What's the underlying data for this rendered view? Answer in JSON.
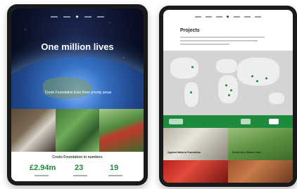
{
  "left_tablet": {
    "hero_title": "One million lives",
    "hero_subtitle": "Credo Foundation lives three priority areas",
    "numbers_title": "Credo Foundation in numbers",
    "stats": [
      "£2.94m",
      "23",
      "19"
    ]
  },
  "right_tablet": {
    "page_title": "Projects",
    "cards": [
      "Against Malaria Foundation",
      "Seeds for a Better Lives"
    ]
  },
  "colors": {
    "accent_green": "#1e8a3c",
    "hero_dark": "#0a0f25",
    "device_frame": "#1a1a1c"
  }
}
